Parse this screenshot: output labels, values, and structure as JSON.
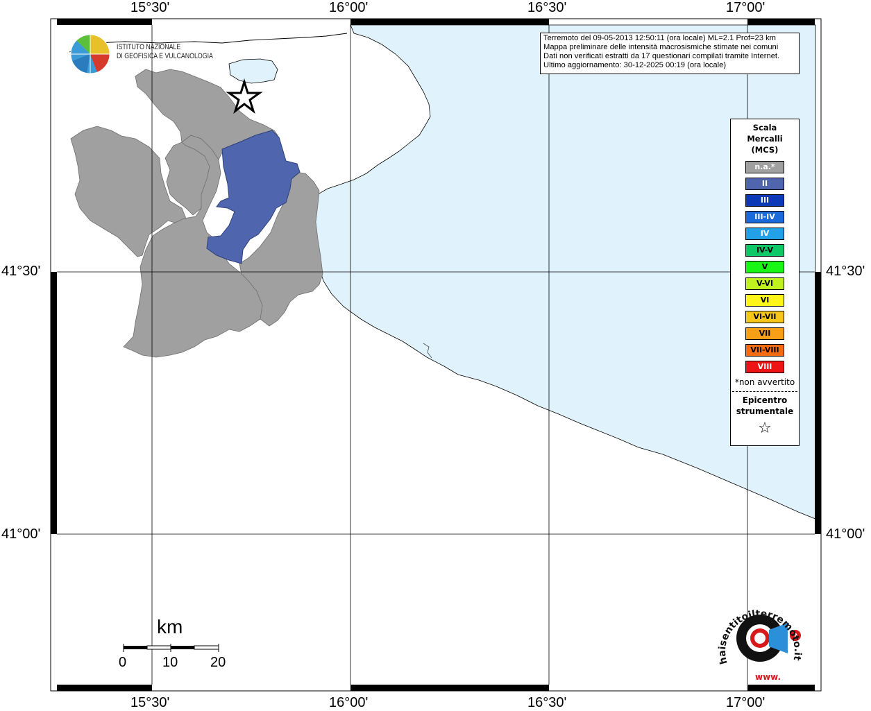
{
  "info": {
    "line1": "Terremoto del 09-05-2013 12:50:11 (ora locale) ML=2.1 Prof=23 km",
    "line2": "Mappa preliminare delle intensità macrosismiche stimate nei comuni",
    "line3": "Dati non verificati estratti da 17 questionari compilati tramite Internet.",
    "line4": "Ultimo aggiornamento: 30-12-2025 00:19 (ora locale)"
  },
  "axes": {
    "top_lon": [
      "15°30'",
      "16°00'",
      "16°30'",
      "17°00'"
    ],
    "bottom_lon": [
      "15°30'",
      "16°00'",
      "16°30'",
      "17°00'"
    ],
    "left_lat": [
      "41°30'",
      "41°00'"
    ],
    "right_lat": [
      "41°30'",
      "41°00'"
    ]
  },
  "legend": {
    "title_line1": "Scala",
    "title_line2": "Mercalli",
    "title_line3": "(MCS)",
    "items": [
      {
        "label": "n.a.*",
        "color": "#a0a0a0",
        "text_color": "#ffffff"
      },
      {
        "label": "II",
        "color": "#4f66af",
        "text_color": "#ffffff"
      },
      {
        "label": "III",
        "color": "#0c39b5",
        "text_color": "#ffffff"
      },
      {
        "label": "III-IV",
        "color": "#1b6ad9",
        "text_color": "#ffffff"
      },
      {
        "label": "IV",
        "color": "#23a1e8",
        "text_color": "#ffffff"
      },
      {
        "label": "IV-V",
        "color": "#0ec866",
        "text_color": "#000000"
      },
      {
        "label": "V",
        "color": "#19f514",
        "text_color": "#000000"
      },
      {
        "label": "V-VI",
        "color": "#bff21f",
        "text_color": "#000000"
      },
      {
        "label": "VI",
        "color": "#fff617",
        "text_color": "#000000"
      },
      {
        "label": "VI-VII",
        "color": "#f6c618",
        "text_color": "#000000"
      },
      {
        "label": "VII",
        "color": "#f79f16",
        "text_color": "#000000"
      },
      {
        "label": "VII-VIII",
        "color": "#f56b12",
        "text_color": "#000000"
      },
      {
        "label": "VIII",
        "color": "#ee1414",
        "text_color": "#ffffff"
      }
    ],
    "note": "*non avvertito",
    "epicenter_line1": "Epicentro",
    "epicenter_line2": "strumentale",
    "epicenter_symbol": "☆"
  },
  "scale_bar": {
    "unit": "km",
    "labels": [
      "0",
      "10",
      "20"
    ]
  },
  "logo": {
    "line1": "ISTITUTO NAZIONALE",
    "line2": "DI GEOFISICA E VULCANOLOGIA"
  },
  "badge": {
    "text": "haisentitoilterremoto.it",
    "prefix": "www."
  },
  "colors": {
    "sea": "#e0f3fd",
    "land_na": "#a0a0a0",
    "intensity_II": "#4f66af",
    "frame": "#000000"
  }
}
